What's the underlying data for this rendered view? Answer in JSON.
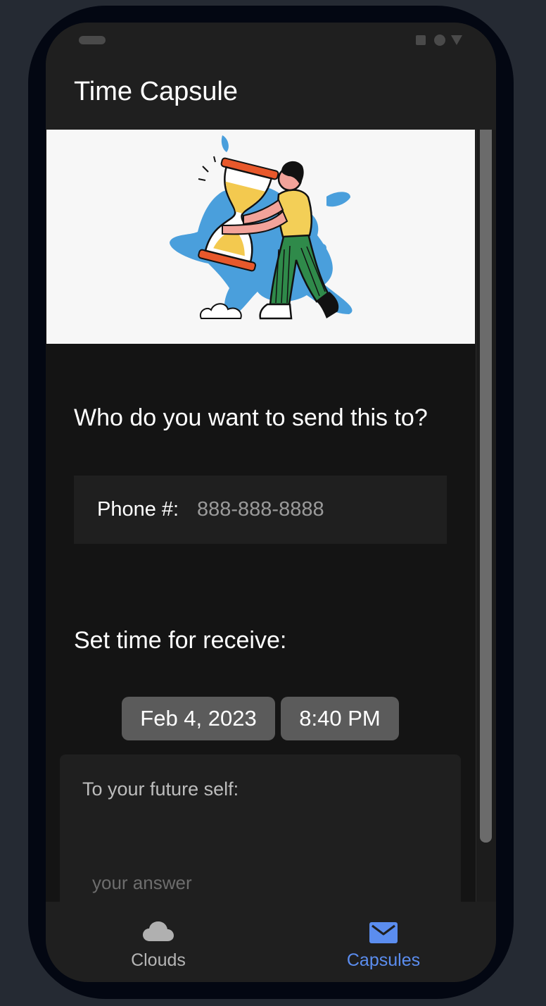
{
  "app": {
    "title": "Time Capsule"
  },
  "hero": {
    "illustration": "person-carrying-hourglass"
  },
  "recipient": {
    "question": "Who do you want to send this to?",
    "phone_label": "Phone #:",
    "phone_placeholder": "888-888-8888",
    "phone_value": ""
  },
  "schedule": {
    "heading": "Set time for receive:",
    "date": "Feb 4, 2023",
    "time": "8:40 PM"
  },
  "message": {
    "label": "To your future self:",
    "placeholder": "your answer",
    "value": ""
  },
  "bottom_nav": {
    "items": [
      {
        "label": "Clouds",
        "icon": "cloud-icon",
        "active": false
      },
      {
        "label": "Capsules",
        "icon": "mail-icon",
        "active": true
      }
    ]
  },
  "colors": {
    "accent": "#5b8def",
    "background": "#141414",
    "surface": "#1f1f1f",
    "chip": "#5b5b5b"
  }
}
